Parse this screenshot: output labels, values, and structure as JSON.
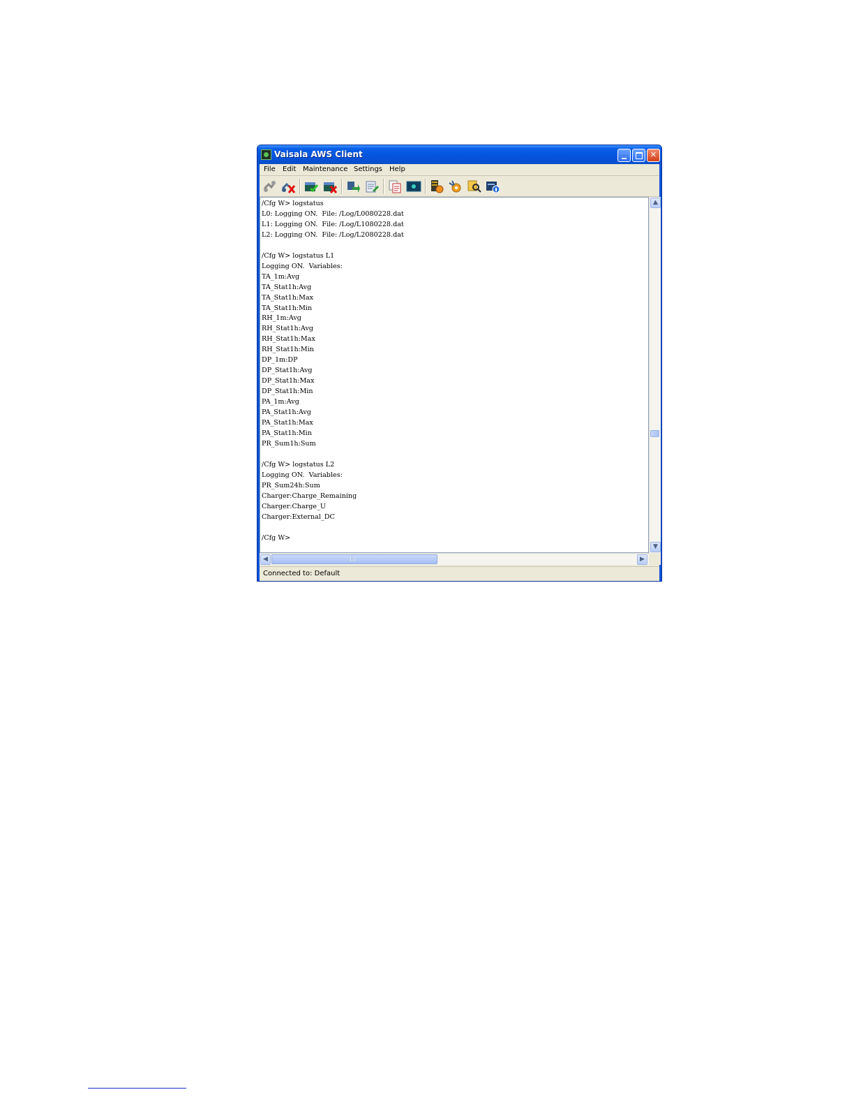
{
  "window": {
    "title": "Vaisala AWS Client",
    "buttons": {
      "minimize": "minimize",
      "maximize": "maximize",
      "close": "close"
    }
  },
  "menu": {
    "items": [
      "File",
      "Edit",
      "Maintenance",
      "Settings",
      "Help"
    ]
  },
  "toolbar": {
    "buttons": [
      "connect-icon",
      "disconnect-icon",
      "open-icon",
      "close-file-icon",
      "upload-icon",
      "edit-icon",
      "copy-icon",
      "terminal-icon",
      "config-icon",
      "service-icon",
      "search-icon",
      "info-icon"
    ]
  },
  "console": {
    "lines": [
      "/Cfg W> logstatus",
      "L0: Logging ON.  File: /Log/L0080228.dat",
      "L1: Logging ON.  File: /Log/L1080228.dat",
      "L2: Logging ON.  File: /Log/L2080228.dat",
      "",
      "/Cfg W> logstatus L1",
      "Logging ON.  Variables:",
      "TA_1m:Avg",
      "TA_Stat1h:Avg",
      "TA_Stat1h:Max",
      "TA_Stat1h:Min",
      "RH_1m:Avg",
      "RH_Stat1h:Avg",
      "RH_Stat1h:Max",
      "RH_Stat1h:Min",
      "DP_1m:DP",
      "DP_Stat1h:Avg",
      "DP_Stat1h:Max",
      "DP_Stat1h:Min",
      "PA_1m:Avg",
      "PA_Stat1h:Avg",
      "PA_Stat1h:Max",
      "PA_Stat1h:Min",
      "PR_Sum1h:Sum",
      "",
      "/Cfg W> logstatus L2",
      "Logging ON.  Variables:",
      "PR_Sum24h:Sum",
      "Charger:Charge_Remaining",
      "Charger:Charge_U",
      "Charger:External_DC",
      "",
      "/Cfg W>"
    ]
  },
  "scrollbars": {
    "up": "▲",
    "down": "▼",
    "left": "◀",
    "right": "▶"
  },
  "status": {
    "text": "Connected to: Default"
  },
  "colors": {
    "titlebar": "#0a55d8",
    "chrome": "#ece9d8",
    "console_bg": "#ffffff",
    "footnote_rule": "#1a33cc"
  }
}
